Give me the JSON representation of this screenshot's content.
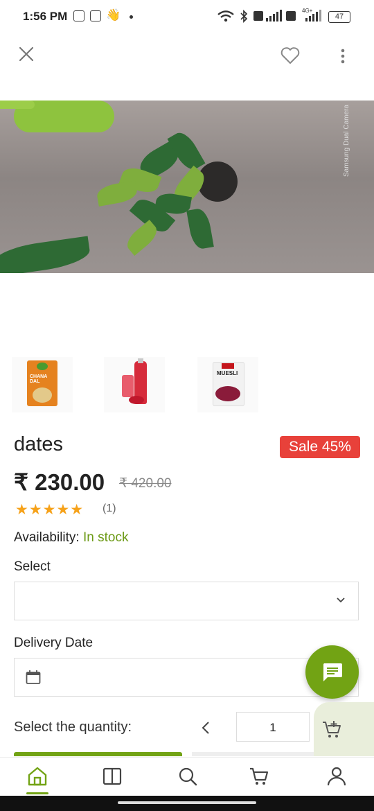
{
  "status_bar": {
    "time": "1:56 PM",
    "battery": "47",
    "network": "4G+"
  },
  "product": {
    "title": "dates",
    "sale_badge": "Sale 45%",
    "price": "₹ 230.00",
    "old_price": "₹ 420.00",
    "rating": {
      "stars": "★★★★★",
      "value": 5,
      "count": "(1)"
    },
    "availability_label": "Availability:",
    "availability_value": "In stock",
    "thumbnails": [
      {
        "name": "chana-dal-thumbnail",
        "text": "CHANA DAL"
      },
      {
        "name": "juice-bottle-thumbnail",
        "text": ""
      },
      {
        "name": "muesli-thumbnail",
        "text": "MUESLI"
      }
    ],
    "image_watermark": "Samsung Dual Camera"
  },
  "form": {
    "select_label": "Select",
    "select_value": "",
    "delivery_label": "Delivery Date",
    "delivery_value": "",
    "quantity_label": "Select the quantity:",
    "quantity_value": "1"
  },
  "icons": {
    "close": "close-icon",
    "wishlist": "heart-icon",
    "more": "more-vertical-icon",
    "chat": "chat-icon",
    "cart_add": "cart-add-icon",
    "home": "home-icon",
    "categories": "book-icon",
    "search": "search-icon",
    "cart": "cart-icon",
    "account": "user-icon"
  },
  "colors": {
    "accent": "#72a314",
    "sale": "#e8413a",
    "in_stock": "#6c9a16",
    "stars": "#f6a21a"
  }
}
